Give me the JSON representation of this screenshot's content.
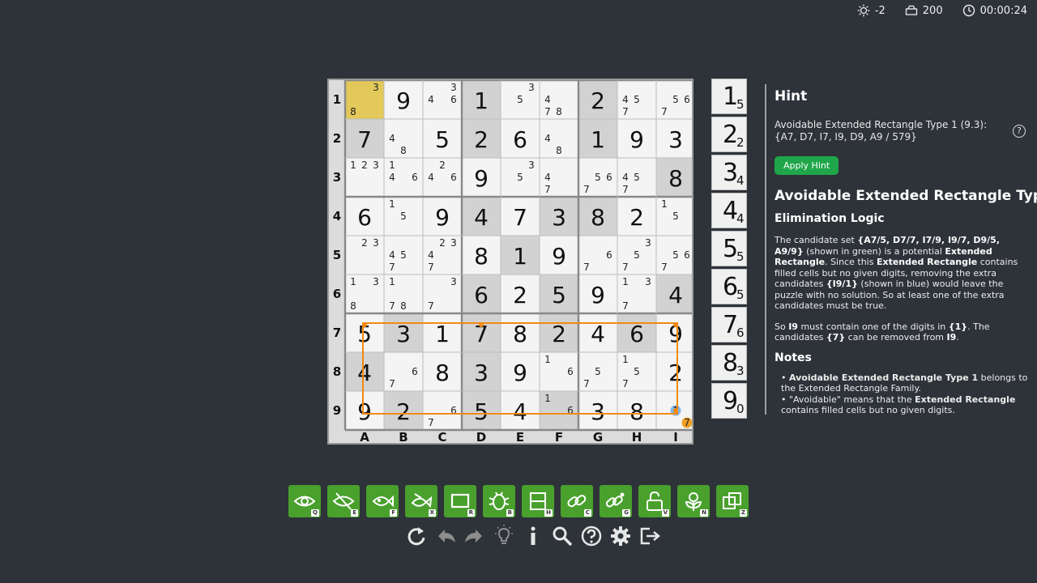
{
  "status": {
    "bulb_count": "-2",
    "score": "200",
    "timer": "00:00:24"
  },
  "board": {
    "row_labels": [
      "1",
      "2",
      "3",
      "4",
      "5",
      "6",
      "7",
      "8",
      "9"
    ],
    "col_labels": [
      "A",
      "B",
      "C",
      "D",
      "E",
      "F",
      "G",
      "H",
      "I"
    ],
    "shaded_boxes": [
      "r1c4",
      "r1c7",
      "r2c1",
      "r2c4",
      "r2c7",
      "r3c9",
      "r4c4",
      "r4c6",
      "r4c7",
      "r5c5",
      "r6c4",
      "r6c6",
      "r6c9",
      "r7c2",
      "r7c4",
      "r7c6",
      "r7c8",
      "r8c1",
      "r8c4",
      "r9c2",
      "r9c4",
      "r9c6"
    ],
    "given_highlight_color": "#e3c85a",
    "selected_cell": "r1c1",
    "cells": [
      [
        {
          "c": [
            "3",
            "8"
          ],
          "p": [
            3,
            7
          ]
        },
        {
          "v": "9"
        },
        {
          "c": [
            "3",
            "4",
            "6"
          ],
          "p": [
            3,
            4,
            6
          ]
        },
        {
          "v": "1"
        },
        {
          "c": [
            "3",
            "5"
          ],
          "p": [
            3,
            5
          ]
        },
        {
          "c": [
            "4",
            "7",
            "8"
          ],
          "p": [
            4,
            7,
            8
          ]
        },
        {
          "v": "2"
        },
        {
          "c": [
            "4",
            "5",
            "7"
          ],
          "p": [
            4,
            5,
            7
          ]
        },
        {
          "c": [
            "5",
            "6",
            "7"
          ],
          "p": [
            5,
            6,
            7
          ]
        }
      ],
      [
        {
          "v": "7"
        },
        {
          "c": [
            "4",
            "8"
          ],
          "p": [
            4,
            8
          ]
        },
        {
          "v": "5"
        },
        {
          "v": "2"
        },
        {
          "v": "6"
        },
        {
          "c": [
            "4",
            "8"
          ],
          "p": [
            4,
            8
          ]
        },
        {
          "v": "1"
        },
        {
          "v": "9"
        },
        {
          "v": "3"
        }
      ],
      [
        {
          "c": [
            "1",
            "2",
            "3"
          ],
          "p": [
            1,
            2,
            3
          ]
        },
        {
          "c": [
            "1",
            "4",
            "6"
          ],
          "p": [
            1,
            4,
            6
          ]
        },
        {
          "c": [
            "2",
            "4",
            "6"
          ],
          "p": [
            2,
            4,
            6
          ]
        },
        {
          "v": "9"
        },
        {
          "c": [
            "3",
            "5"
          ],
          "p": [
            3,
            5
          ]
        },
        {
          "c": [
            "4",
            "7"
          ],
          "p": [
            4,
            7
          ]
        },
        {
          "c": [
            "5",
            "6",
            "7"
          ],
          "p": [
            5,
            6,
            7
          ]
        },
        {
          "c": [
            "4",
            "5",
            "7"
          ],
          "p": [
            4,
            5,
            7
          ]
        },
        {
          "v": "8"
        }
      ],
      [
        {
          "v": "6"
        },
        {
          "c": [
            "1",
            "5"
          ],
          "p": [
            1,
            5
          ]
        },
        {
          "v": "9"
        },
        {
          "v": "4"
        },
        {
          "v": "7"
        },
        {
          "v": "3"
        },
        {
          "v": "8"
        },
        {
          "v": "2"
        },
        {
          "c": [
            "1",
            "5"
          ],
          "p": [
            1,
            5
          ]
        }
      ],
      [
        {
          "c": [
            "2",
            "3"
          ],
          "p": [
            2,
            3
          ]
        },
        {
          "c": [
            "4",
            "5",
            "7"
          ],
          "p": [
            4,
            5,
            7
          ]
        },
        {
          "c": [
            "2",
            "3",
            "4",
            "7"
          ],
          "p": [
            2,
            3,
            4,
            7
          ]
        },
        {
          "v": "8"
        },
        {
          "v": "1"
        },
        {
          "v": "9"
        },
        {
          "c": [
            "6",
            "7"
          ],
          "p": [
            6,
            7
          ]
        },
        {
          "c": [
            "3",
            "5",
            "7"
          ],
          "p": [
            3,
            5,
            7
          ]
        },
        {
          "c": [
            "5",
            "6",
            "7"
          ],
          "p": [
            5,
            6,
            7
          ]
        }
      ],
      [
        {
          "c": [
            "1",
            "3",
            "8"
          ],
          "p": [
            1,
            3,
            7
          ]
        },
        {
          "c": [
            "1",
            "7",
            "8"
          ],
          "p": [
            1,
            7,
            8
          ]
        },
        {
          "c": [
            "3",
            "7"
          ],
          "p": [
            3,
            7
          ]
        },
        {
          "v": "6"
        },
        {
          "v": "2"
        },
        {
          "v": "5"
        },
        {
          "v": "9"
        },
        {
          "c": [
            "1",
            "3",
            "7"
          ],
          "p": [
            1,
            3,
            7
          ]
        },
        {
          "v": "4"
        }
      ],
      [
        {
          "v": "5"
        },
        {
          "v": "3"
        },
        {
          "v": "1"
        },
        {
          "v": "7"
        },
        {
          "v": "8"
        },
        {
          "v": "2"
        },
        {
          "v": "4"
        },
        {
          "v": "6"
        },
        {
          "v": "9"
        }
      ],
      [
        {
          "v": "4"
        },
        {
          "c": [
            "6",
            "7"
          ],
          "p": [
            6,
            7
          ]
        },
        {
          "v": "8"
        },
        {
          "v": "3"
        },
        {
          "v": "9"
        },
        {
          "c": [
            "1",
            "6"
          ],
          "p": [
            1,
            6
          ]
        },
        {
          "c": [
            "5",
            "7"
          ],
          "p": [
            5,
            7
          ]
        },
        {
          "c": [
            "1",
            "5",
            "7"
          ],
          "p": [
            1,
            5,
            7
          ]
        },
        {
          "v": "2"
        }
      ],
      [
        {
          "v": "9"
        },
        {
          "v": "2"
        },
        {
          "c": [
            "6",
            "7"
          ],
          "p": [
            6,
            7
          ]
        },
        {
          "v": "5"
        },
        {
          "v": "4"
        },
        {
          "c": [
            "1",
            "6"
          ],
          "p": [
            1,
            6
          ]
        },
        {
          "v": "3"
        },
        {
          "v": "8"
        },
        {
          "c": [
            "1",
            "7"
          ],
          "p": [
            5,
            9
          ],
          "hl": {
            "1": "#7fb8f0",
            "7": "#f0a020"
          }
        }
      ]
    ],
    "rectangle_color": "#f08a10"
  },
  "digit_counts": [
    {
      "digit": "1",
      "remaining": "5"
    },
    {
      "digit": "2",
      "remaining": "2"
    },
    {
      "digit": "3",
      "remaining": "4"
    },
    {
      "digit": "4",
      "remaining": "4"
    },
    {
      "digit": "5",
      "remaining": "5"
    },
    {
      "digit": "6",
      "remaining": "5"
    },
    {
      "digit": "7",
      "remaining": "6"
    },
    {
      "digit": "8",
      "remaining": "3"
    },
    {
      "digit": "9",
      "remaining": "0"
    }
  ],
  "panel": {
    "heading": "Hint",
    "hint_text": "Avoidable Extended Rectangle Type 1 (9.3): {A7, D7, I7, I9, D9, A9 / 579}",
    "apply_label": "Apply Hint",
    "title": "Avoidable Extended Rectangle Type",
    "logic_heading": "Elimination Logic",
    "p1": {
      "t1": "The candidate set ",
      "b1": "{A7/5, D7/7, I7/9, I9/7, D9/5, A9/9}",
      "t2": " (shown in green) is a potential ",
      "b2": "Extended Rectangle",
      "t3": ". Since this ",
      "b3": "Extended Rectangle",
      "t4": " contains filled cells but no given digits, removing the extra candidates ",
      "b4": "{I9/1}",
      "t5": " (shown in blue) would leave the puzzle with no solution. So at least one of the extra candidates must be true."
    },
    "p2": {
      "t1": "So ",
      "b1": "I9",
      "t2": " must contain one of the digits in ",
      "b2": "{1}",
      "t3": ". The candidates ",
      "b3": "{7}",
      "t4": " can be removed from ",
      "b4": "I9",
      "t5": "."
    },
    "notes_heading": "Notes",
    "note1": {
      "bullet": "• ",
      "b1": "Avoidable Extended Rectangle Type 1",
      "t1": " belongs to the ",
      "link": "Extended Rectangle Family",
      "t2": "."
    },
    "note2": {
      "t0": "• \"",
      "link": "Avoidable",
      "t1": "\" means that the ",
      "b1": "Extended Rectangle",
      "t2": " contains filled cells but no given digits."
    }
  },
  "toolbar": [
    {
      "name": "eye-icon",
      "key": "Q"
    },
    {
      "name": "eye-off-icon",
      "key": "E"
    },
    {
      "name": "fish-eye-icon",
      "key": "F"
    },
    {
      "name": "fish-x-icon",
      "key": "X"
    },
    {
      "name": "rectangle-icon",
      "key": "R"
    },
    {
      "name": "bug-icon",
      "key": "B"
    },
    {
      "name": "hidden-rectangle-icon",
      "key": "H"
    },
    {
      "name": "chain-icon",
      "key": "C"
    },
    {
      "name": "group-chain-icon",
      "key": "G"
    },
    {
      "name": "unlock-icon",
      "key": "V"
    },
    {
      "name": "flower-icon",
      "key": "N"
    },
    {
      "name": "overlap-icon",
      "key": "Z"
    }
  ],
  "actions": [
    "restart-icon",
    "undo-icon",
    "redo-icon",
    "lightbulb-icon",
    "info-icon",
    "magnify-icon",
    "help-icon",
    "settings-icon",
    "exit-icon"
  ]
}
